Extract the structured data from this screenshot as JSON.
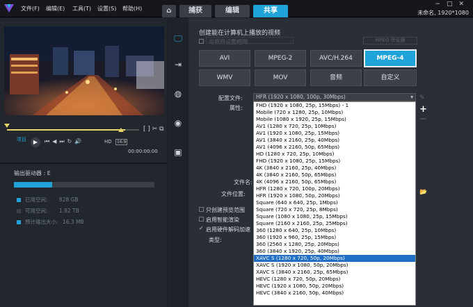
{
  "menu": {
    "items": [
      "文件(F)",
      "编辑(E)",
      "工具(T)",
      "设置(S)",
      "帮助(H)"
    ]
  },
  "tabs": [
    {
      "label": "捕获"
    },
    {
      "label": "编辑"
    },
    {
      "label": "共享"
    }
  ],
  "project": {
    "name": "未命名, 1920*1080"
  },
  "player": {
    "mode_label": "项目",
    "hd_label": "HD",
    "ratio_label": "16:9",
    "timecode": "00:00:00:00"
  },
  "disk": {
    "output_drive": "输出驱动器 : E",
    "usage_fraction": 0.27,
    "used_label": "已用空间:",
    "used_value": "828 GB",
    "free_label": "可用空间:",
    "free_value": "1.92 TB",
    "est_label": "预计输出大小:",
    "est_value": "16.3 MB"
  },
  "share": {
    "heading": "创建能在计算机上播放的视频",
    "match_settings": "与项目设置相同",
    "mpeg_optimizer": "MPEG 优化器",
    "formats": [
      "AVI",
      "MPEG-2",
      "AVC/H.264",
      "MPEG-4",
      "WMV",
      "MOV",
      "音频",
      "自定义"
    ],
    "active_format": "MPEG-4",
    "profile_label": "配置文件:",
    "attributes_label": "属性:",
    "profile_value": "HFR (1920 x 1080, 100p, 30Mbps)",
    "filename_label": "文件名:",
    "location_label": "文件位置:",
    "only_preview": "只创建预览范围",
    "smart_render": "启用智能渲染",
    "hw_decode": "启用硬件解码加速",
    "type_label": "类型:",
    "profiles": [
      "FHD (1920 x 1080, 25p, 15Mbps) - 1",
      "Mobile (720 x 1280, 25p, 10Mbps)",
      "Mobile (1080 x 1920, 25p, 15Mbps)",
      "AV1 (1280 x 720, 25p, 10Mbps)",
      "AV1 (1920 x 1080, 25p, 15Mbps)",
      "AV1 (3840 x 2160, 25p, 40Mbps)",
      "AV1 (4096 x 2160, 50p, 65Mbps)",
      "HD (1280 x 720, 25p, 10Mbps)",
      "FHD (1920 x 1080, 25p, 15Mbps)",
      "4K (3840 x 2160, 25p, 40Mbps)",
      "4K (3840 x 2160, 50p, 65Mbps)",
      "4K (4096 x 2160, 50p, 65Mbps)",
      "HFR (1280 x 720, 100p, 20Mbps)",
      "HFR (1920 x 1080, 50p, 20Mbps)",
      "Square (640 x 640, 25p, 1Mbps)",
      "Square (720 x 720, 25p, 8Mbps)",
      "Square (1080 x 1080, 25p, 15Mbps)",
      "Square (2160 x 2160, 25p, 25Mbps)",
      "360 (1280 x 640, 25p, 10Mbps)",
      "360 (1920 x 960, 25p, 15Mbps)",
      "360 (2560 x 1280, 25p, 20Mbps)",
      "360 (3840 x 1920, 25p, 40Mbps)",
      "XAVC S (1280 x 720, 50p, 20Mbps)",
      "XAVC S (1920 x 1080, 50p, 20Mbps)",
      "XAVC S (3840 x 2160, 25p, 65Mbps)",
      "HEVC (1280 x 720, 50p, 20Mbps)",
      "HEVC (1920 x 1080, 50p, 20Mbps)",
      "HEVC (3840 x 2160, 50p, 40Mbps)"
    ],
    "selected_index": 22
  },
  "colors": {
    "accent": "#1fa3d8",
    "selection": "#1f6fc4"
  },
  "icons": [
    "monitor-icon",
    "device-icon",
    "globe-icon",
    "disc-icon",
    "template-icon",
    "plus-icon",
    "minus-icon",
    "folder-icon"
  ]
}
